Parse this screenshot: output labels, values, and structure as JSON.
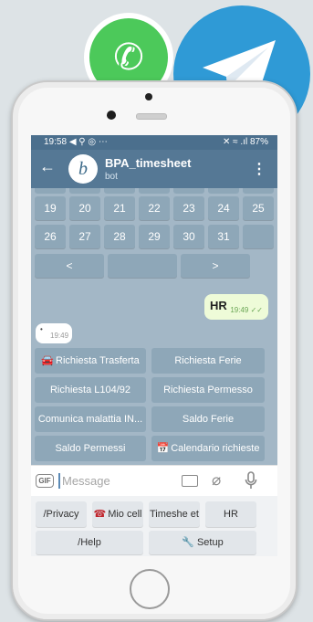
{
  "status_bar": {
    "time": "19:58",
    "left_icons": "◀ ⚲ ◎ ⋯",
    "right_icons": "✕ ≈ .ıl",
    "battery": "87%"
  },
  "chat": {
    "name": "BPA_timesheet",
    "subtitle": "bot",
    "avatar_text": "b"
  },
  "calendar": {
    "rows": [
      [
        "19",
        "20",
        "21",
        "22",
        "23",
        "24",
        "25"
      ],
      [
        "26",
        "27",
        "28",
        "29",
        "30",
        "31",
        ""
      ]
    ],
    "nav": [
      "<",
      "",
      ">"
    ]
  },
  "messages": {
    "outgoing": {
      "text": "HR",
      "time": "19:49",
      "ticks": "✓✓"
    },
    "incoming": {
      "mark": "•",
      "time": "19:49"
    }
  },
  "inline_keyboard": [
    {
      "label": "Richiesta Trasferta",
      "emoji": "🚘"
    },
    {
      "label": "Richiesta Ferie",
      "emoji": ""
    },
    {
      "label": "Richiesta L104/92",
      "emoji": ""
    },
    {
      "label": "Richiesta Permesso",
      "emoji": ""
    },
    {
      "label": "Comunica malattia IN...",
      "emoji": ""
    },
    {
      "label": "Saldo Ferie",
      "emoji": ""
    },
    {
      "label": "Saldo Permessi",
      "emoji": ""
    },
    {
      "label": "Calendario richieste",
      "emoji": "📅"
    }
  ],
  "input": {
    "placeholder": "Message",
    "gif": "GIF"
  },
  "reply_keyboard": {
    "row1": [
      {
        "label": "/Privacy",
        "emoji": ""
      },
      {
        "label": "Mio cell",
        "emoji": "☎"
      },
      {
        "label": "Timeshe et",
        "emoji": ""
      },
      {
        "label": "HR",
        "emoji": ""
      }
    ],
    "row2": [
      {
        "label": "/Help",
        "emoji": ""
      },
      {
        "label": "Setup",
        "emoji": "🔧"
      }
    ]
  },
  "colors": {
    "header": "#557895",
    "button": "#8ea7b8",
    "whatsapp": "#4cc95a",
    "telegram": "#2f9ad6"
  }
}
